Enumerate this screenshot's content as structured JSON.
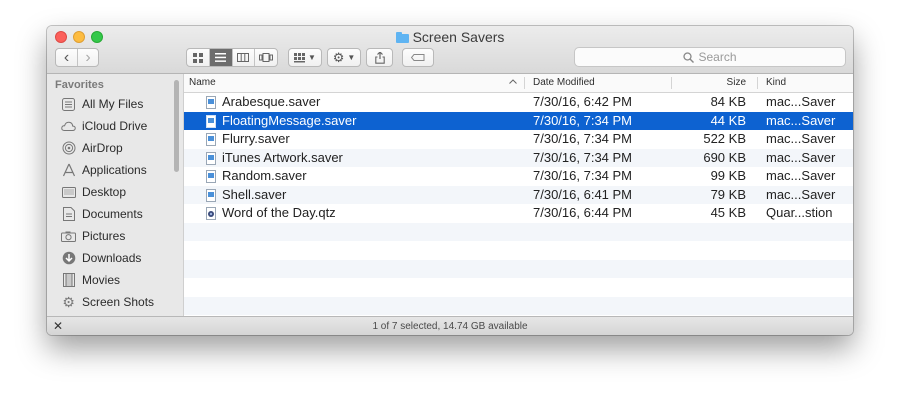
{
  "window": {
    "title": "Screen Savers",
    "title_icon": "folder-icon"
  },
  "toolbar": {
    "back_glyph": "‹",
    "forward_glyph": "›",
    "search_placeholder": "Search",
    "view_modes": [
      "icon-view",
      "list-view",
      "column-view",
      "cover-flow-view"
    ],
    "active_view": "list-view"
  },
  "sidebar": {
    "heading": "Favorites",
    "items": [
      {
        "label": "All My Files",
        "icon": "all-files-icon"
      },
      {
        "label": "iCloud Drive",
        "icon": "cloud-icon"
      },
      {
        "label": "AirDrop",
        "icon": "airdrop-icon"
      },
      {
        "label": "Applications",
        "icon": "applications-icon"
      },
      {
        "label": "Desktop",
        "icon": "desktop-icon"
      },
      {
        "label": "Documents",
        "icon": "documents-icon"
      },
      {
        "label": "Pictures",
        "icon": "camera-icon"
      },
      {
        "label": "Downloads",
        "icon": "download-icon"
      },
      {
        "label": "Movies",
        "icon": "film-icon"
      },
      {
        "label": "Screen Shots",
        "icon": "gear-icon"
      }
    ]
  },
  "columns": {
    "name": "Name",
    "date": "Date Modified",
    "size": "Size",
    "kind": "Kind",
    "sort_indicator": "^"
  },
  "files": [
    {
      "name": "Arabesque.saver",
      "date": "7/30/16, 6:42 PM",
      "size": "84 KB",
      "kind": "mac...Saver",
      "selected": false,
      "icon": "saver-file-icon"
    },
    {
      "name": "FloatingMessage.saver",
      "date": "7/30/16, 7:34 PM",
      "size": "44 KB",
      "kind": "mac...Saver",
      "selected": true,
      "icon": "saver-file-icon"
    },
    {
      "name": "Flurry.saver",
      "date": "7/30/16, 7:34 PM",
      "size": "522 KB",
      "kind": "mac...Saver",
      "selected": false,
      "icon": "saver-file-icon"
    },
    {
      "name": "iTunes Artwork.saver",
      "date": "7/30/16, 7:34 PM",
      "size": "690 KB",
      "kind": "mac...Saver",
      "selected": false,
      "icon": "saver-file-icon"
    },
    {
      "name": "Random.saver",
      "date": "7/30/16, 7:34 PM",
      "size": "99 KB",
      "kind": "mac...Saver",
      "selected": false,
      "icon": "saver-file-icon"
    },
    {
      "name": "Shell.saver",
      "date": "7/30/16, 6:41 PM",
      "size": "79 KB",
      "kind": "mac...Saver",
      "selected": false,
      "icon": "saver-file-icon"
    },
    {
      "name": "Word of the Day.qtz",
      "date": "7/30/16, 6:44 PM",
      "size": "45 KB",
      "kind": "Quar...stion",
      "selected": false,
      "icon": "quartz-file-icon"
    }
  ],
  "status": {
    "text": "1 of 7 selected, 14.74 GB available"
  },
  "colors": {
    "selection": "#0d62d1",
    "close": "#fc605b",
    "minimize": "#fdbc40",
    "maximize": "#34c84a"
  }
}
